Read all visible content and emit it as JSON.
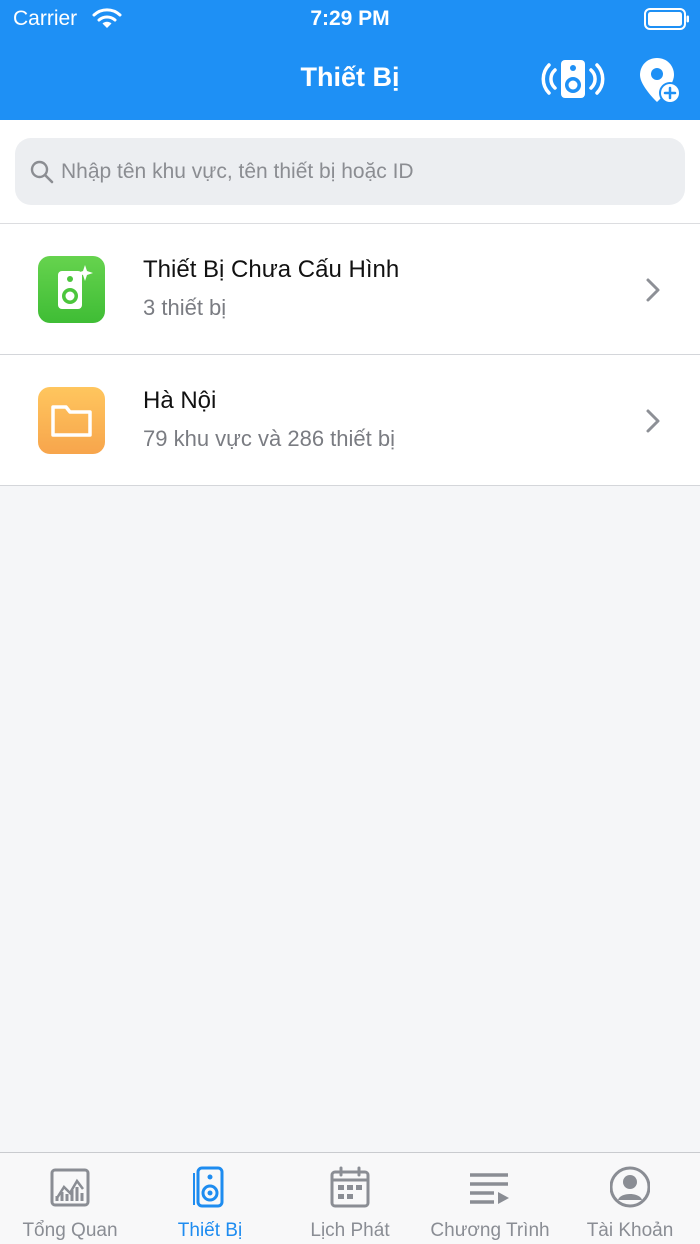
{
  "status_bar": {
    "carrier": "Carrier",
    "time": "7:29 PM"
  },
  "nav": {
    "title": "Thiết Bị"
  },
  "search": {
    "placeholder": "Nhập tên khu vực, tên thiết bị hoặc ID"
  },
  "rows": [
    {
      "title": "Thiết Bị Chưa Cấu Hình",
      "subtitle": "3 thiết bị",
      "icon": "speaker-sparkle-icon"
    },
    {
      "title": "Hà Nội",
      "subtitle": "79 khu vực và 286 thiết bị",
      "icon": "folder-icon"
    }
  ],
  "tabs": [
    {
      "label": "Tổng Quan",
      "icon": "chart-icon",
      "active": false
    },
    {
      "label": "Thiết Bị",
      "icon": "speaker-icon",
      "active": true
    },
    {
      "label": "Lịch Phát",
      "icon": "calendar-icon",
      "active": false
    },
    {
      "label": "Chương Trình",
      "icon": "playlist-icon",
      "active": false
    },
    {
      "label": "Tài Khoản",
      "icon": "account-icon",
      "active": false
    }
  ],
  "colors": {
    "primary": "#1e90f5",
    "green_icon": "#4cc63c",
    "orange_icon": "#f9b455",
    "inactive_tab": "#8a8d94"
  }
}
